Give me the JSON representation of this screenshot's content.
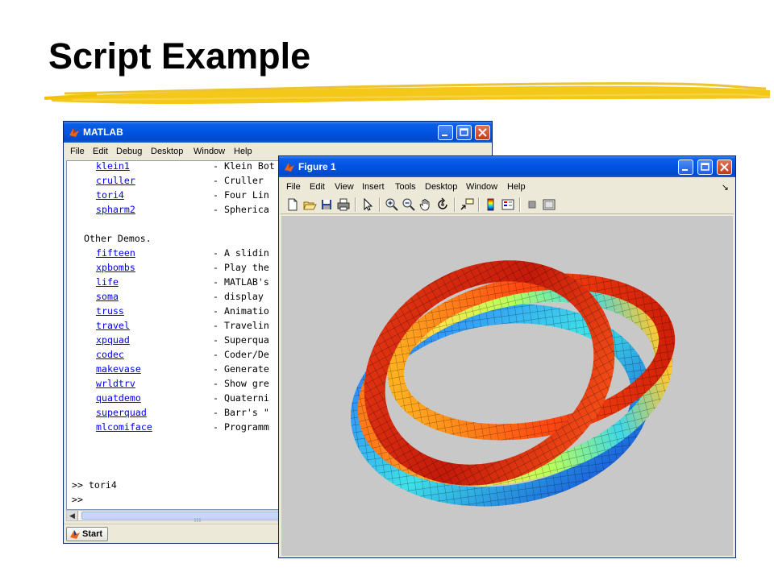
{
  "slide": {
    "title": "Script Example",
    "accent_color": "#f2c200"
  },
  "matlab": {
    "title": "MATLAB",
    "menu": [
      "File",
      "Edit",
      "Debug",
      "Desktop",
      "Window",
      "Help"
    ],
    "demo_rows": [
      {
        "name": "klein1",
        "desc": "- Klein Bot"
      },
      {
        "name": "cruller",
        "desc": "- Cruller"
      },
      {
        "name": "tori4",
        "desc": "- Four Lin"
      },
      {
        "name": "spharm2",
        "desc": "- Spherica"
      }
    ],
    "section_heading": "Other Demos.",
    "other_rows": [
      {
        "name": "fifteen",
        "desc": "- A slidin"
      },
      {
        "name": "xpbombs",
        "desc": "- Play the"
      },
      {
        "name": "life",
        "desc": "- MATLAB's"
      },
      {
        "name": "soma",
        "desc": "- display"
      },
      {
        "name": "truss",
        "desc": "- Animatio"
      },
      {
        "name": "travel",
        "desc": "- Travelin"
      },
      {
        "name": "xpquad",
        "desc": "- Superqua"
      },
      {
        "name": "codec",
        "desc": "- Coder/De"
      },
      {
        "name": "makevase",
        "desc": "- Generate"
      },
      {
        "name": "wrldtrv",
        "desc": "- Show gre"
      },
      {
        "name": "quatdemo",
        "desc": "- Quaterni"
      },
      {
        "name": "superquad",
        "desc": "- Barr's \""
      },
      {
        "name": "mlcomiface",
        "desc": "- Programm"
      }
    ],
    "command_history": [
      ">> tori4",
      ">>"
    ],
    "start_label": "Start"
  },
  "figure": {
    "title": "Figure 1",
    "menu": [
      "File",
      "Edit",
      "View",
      "Insert",
      "Tools",
      "Desktop",
      "Window",
      "Help"
    ],
    "toolbar_icons": [
      "new-figure-icon",
      "open-file-icon",
      "save-icon",
      "print-icon",
      "edit-plot-icon",
      "zoom-in-icon",
      "zoom-out-icon",
      "pan-icon",
      "rotate-3d-icon",
      "data-cursor-icon",
      "colorbar-icon",
      "legend-icon",
      "hide-plot-tools-icon",
      "show-plot-tools-icon"
    ],
    "axes_background": "#c8c8c8"
  }
}
